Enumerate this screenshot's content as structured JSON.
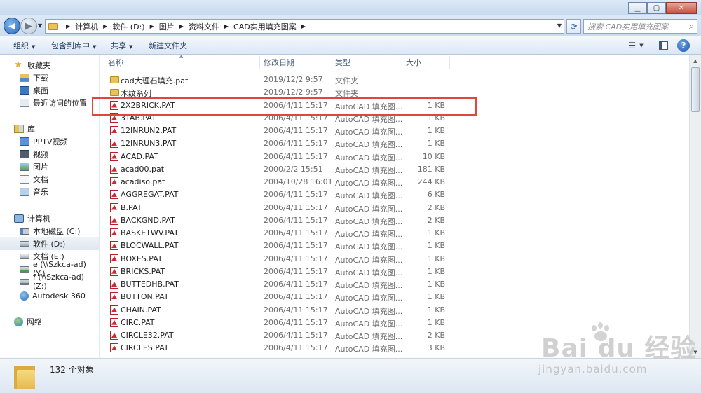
{
  "window": {
    "controls": {
      "minimize": "▁",
      "maximize": "▢",
      "close": "✕"
    }
  },
  "address": {
    "crumbs": [
      "计算机",
      "软件 (D:)",
      "图片",
      "资料文件",
      "CAD实用填充图案"
    ],
    "search_placeholder": "搜索 CAD实用填充图案"
  },
  "toolbar": {
    "organize": "组织",
    "include_library": "包含到库中",
    "share": "共享",
    "new_folder": "新建文件夹"
  },
  "nav": {
    "favorites": {
      "label": "收藏夹",
      "items": [
        "下载",
        "桌面",
        "最近访问的位置"
      ]
    },
    "libraries": {
      "label": "库",
      "items": [
        "PPTV视频",
        "视频",
        "图片",
        "文档",
        "音乐"
      ]
    },
    "computer": {
      "label": "计算机",
      "items": [
        "本地磁盘 (C:)",
        "软件 (D:)",
        "文档 (E:)",
        "e (\\\\Szkca-ad) (Y:)",
        "f (\\\\Szkca-ad) (Z:)",
        "Autodesk 360"
      ]
    },
    "network": {
      "label": "网络"
    },
    "selected": "软件 (D:)"
  },
  "columns": {
    "name": "名称",
    "date": "修改日期",
    "type": "类型",
    "size": "大小"
  },
  "files": [
    {
      "name": "cad大理石填充.pat",
      "date": "2019/12/2 9:57",
      "type": "文件夹",
      "size": "",
      "kind": "folder"
    },
    {
      "name": "木纹系列",
      "date": "2019/12/2 9:57",
      "type": "文件夹",
      "size": "",
      "kind": "folder"
    },
    {
      "name": "2X2BRICK.PAT",
      "date": "2006/4/11 15:17",
      "type": "AutoCAD 填充图...",
      "size": "1 KB",
      "kind": "pat"
    },
    {
      "name": "3TAB.PAT",
      "date": "2006/4/11 15:17",
      "type": "AutoCAD 填充图...",
      "size": "1 KB",
      "kind": "pat"
    },
    {
      "name": "12INRUN2.PAT",
      "date": "2006/4/11 15:17",
      "type": "AutoCAD 填充图...",
      "size": "1 KB",
      "kind": "pat"
    },
    {
      "name": "12INRUN3.PAT",
      "date": "2006/4/11 15:17",
      "type": "AutoCAD 填充图...",
      "size": "1 KB",
      "kind": "pat"
    },
    {
      "name": "ACAD.PAT",
      "date": "2006/4/11 15:17",
      "type": "AutoCAD 填充图...",
      "size": "10 KB",
      "kind": "pat"
    },
    {
      "name": "acad00.pat",
      "date": "2000/2/2 15:51",
      "type": "AutoCAD 填充图...",
      "size": "181 KB",
      "kind": "pat"
    },
    {
      "name": "acadiso.pat",
      "date": "2004/10/28 16:01",
      "type": "AutoCAD 填充图...",
      "size": "244 KB",
      "kind": "pat"
    },
    {
      "name": "AGGREGAT.PAT",
      "date": "2006/4/11 15:17",
      "type": "AutoCAD 填充图...",
      "size": "6 KB",
      "kind": "pat"
    },
    {
      "name": "B.PAT",
      "date": "2006/4/11 15:17",
      "type": "AutoCAD 填充图...",
      "size": "2 KB",
      "kind": "pat"
    },
    {
      "name": "BACKGND.PAT",
      "date": "2006/4/11 15:17",
      "type": "AutoCAD 填充图...",
      "size": "2 KB",
      "kind": "pat"
    },
    {
      "name": "BASKETWV.PAT",
      "date": "2006/4/11 15:17",
      "type": "AutoCAD 填充图...",
      "size": "1 KB",
      "kind": "pat"
    },
    {
      "name": "BLOCWALL.PAT",
      "date": "2006/4/11 15:17",
      "type": "AutoCAD 填充图...",
      "size": "1 KB",
      "kind": "pat"
    },
    {
      "name": "BOXES.PAT",
      "date": "2006/4/11 15:17",
      "type": "AutoCAD 填充图...",
      "size": "1 KB",
      "kind": "pat"
    },
    {
      "name": "BRICKS.PAT",
      "date": "2006/4/11 15:17",
      "type": "AutoCAD 填充图...",
      "size": "1 KB",
      "kind": "pat"
    },
    {
      "name": "BUTTEDHB.PAT",
      "date": "2006/4/11 15:17",
      "type": "AutoCAD 填充图...",
      "size": "1 KB",
      "kind": "pat"
    },
    {
      "name": "BUTTON.PAT",
      "date": "2006/4/11 15:17",
      "type": "AutoCAD 填充图...",
      "size": "1 KB",
      "kind": "pat"
    },
    {
      "name": "CHAIN.PAT",
      "date": "2006/4/11 15:17",
      "type": "AutoCAD 填充图...",
      "size": "1 KB",
      "kind": "pat"
    },
    {
      "name": "CIRC.PAT",
      "date": "2006/4/11 15:17",
      "type": "AutoCAD 填充图...",
      "size": "1 KB",
      "kind": "pat"
    },
    {
      "name": "CIRCLE32.PAT",
      "date": "2006/4/11 15:17",
      "type": "AutoCAD 填充图...",
      "size": "2 KB",
      "kind": "pat"
    },
    {
      "name": "CIRCLES.PAT",
      "date": "2006/4/11 15:17",
      "type": "AutoCAD 填充图...",
      "size": "3 KB",
      "kind": "pat"
    }
  ],
  "highlighted_file": "2X2BRICK.PAT",
  "status": {
    "count": "132 个对象"
  },
  "watermark": {
    "logo": "Bai du 经验",
    "url": "jingyan.baidu.com"
  }
}
